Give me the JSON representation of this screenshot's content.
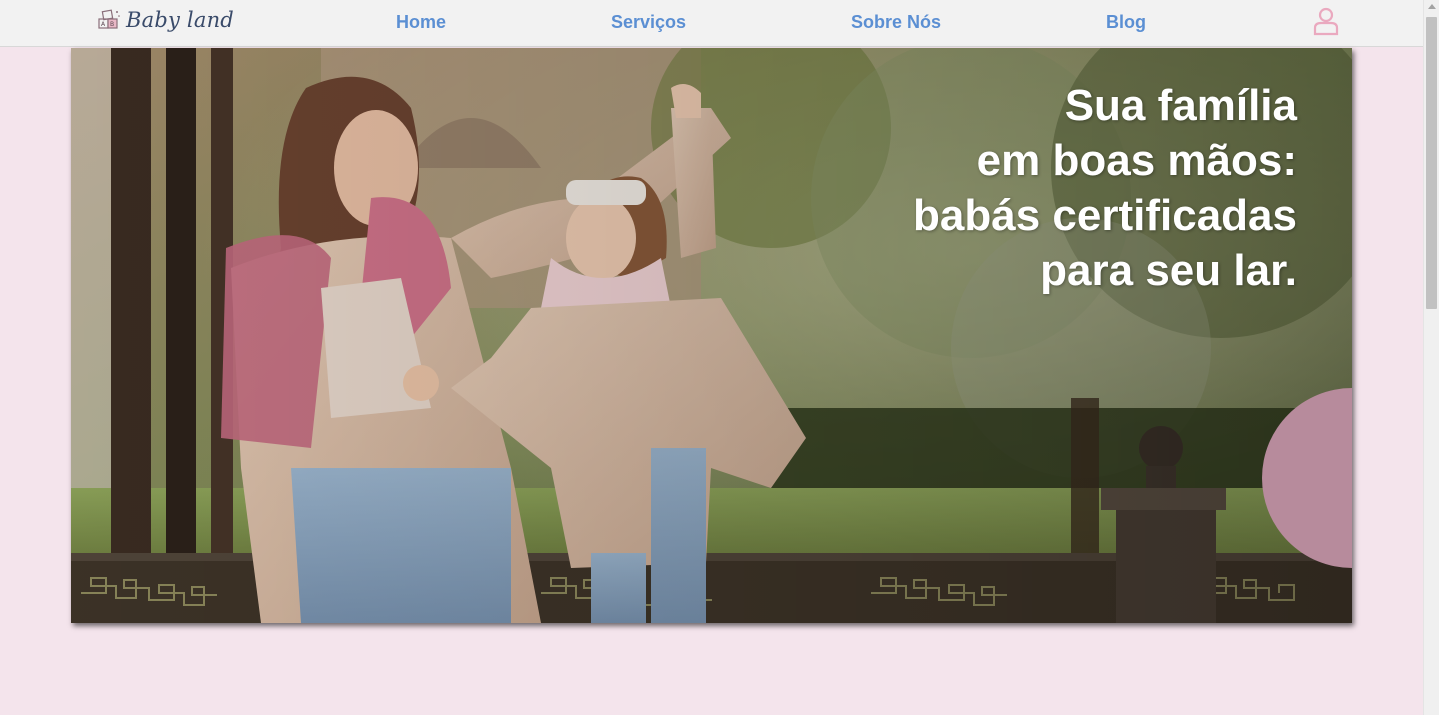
{
  "brand": {
    "name": "Baby land",
    "icon": "toy-blocks-logo-icon"
  },
  "nav": {
    "items": [
      {
        "label": "Home"
      },
      {
        "label": "Serviços"
      },
      {
        "label": "Sobre Nós"
      },
      {
        "label": "Blog"
      }
    ],
    "link_color": "#5b8fd3",
    "user_icon": "user-account-icon",
    "user_icon_color": "#eaa9bf"
  },
  "hero": {
    "image": "mother-and-daughter-playing-in-park-photo",
    "headline": {
      "line1": "Sua família",
      "line2": "em boas mãos:",
      "line3": "babás certificadas",
      "line4": "para seu lar."
    },
    "accent_color": "#b78b9c"
  },
  "theme": {
    "background": "#f4e4ec",
    "navbar_background": "#f2f2f2"
  }
}
